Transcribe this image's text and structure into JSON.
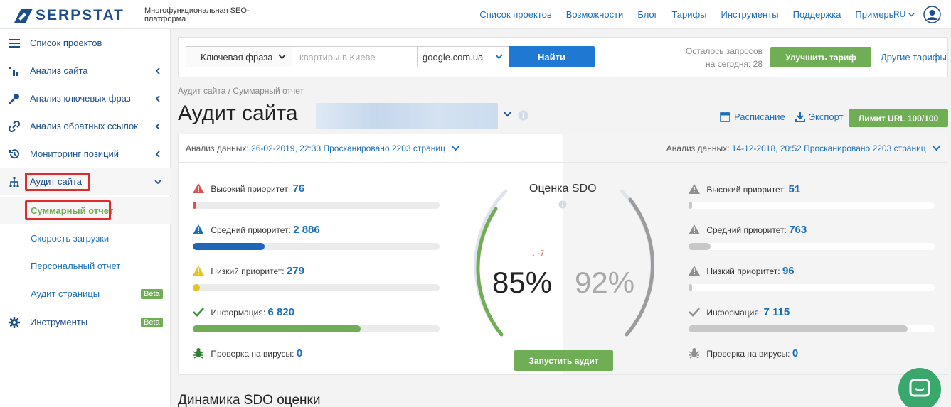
{
  "header": {
    "logo": "SERPSTAT",
    "tagline": "Многофункциональная SEO-платформа",
    "nav": [
      "Список проектов",
      "Возможности",
      "Блог",
      "Тарифы",
      "Инструменты",
      "Поддержка",
      "Примеры"
    ],
    "lang": "RU"
  },
  "sidebar": {
    "items": [
      {
        "label": "Список проектов",
        "icon": "menu-icon"
      },
      {
        "label": "Анализ сайта",
        "icon": "bar-chart-icon"
      },
      {
        "label": "Анализ ключевых фраз",
        "icon": "key-icon"
      },
      {
        "label": "Анализ обратных ссылок",
        "icon": "link-icon"
      },
      {
        "label": "Мониторинг позиций",
        "icon": "history-icon"
      },
      {
        "label": "Аудит сайта",
        "icon": "sitemap-icon"
      }
    ],
    "sub": [
      "Суммарный отчет",
      "Скорость загрузки",
      "Персональный отчет",
      "Аудит страницы"
    ],
    "beta": "Beta",
    "tools": "Инструменты"
  },
  "search": {
    "type": "Ключевая фраза",
    "placeholder": "квартиры в Киеве",
    "engine": "google.com.ua",
    "button": "Найти",
    "quota_line1": "Осталось запросов",
    "quota_line2": "на сегодня: 28",
    "upgrade": "Улучшить тариф",
    "other": "Другие тарифы"
  },
  "page": {
    "breadcrumb": "Аудит сайта / Суммарный отчет",
    "title": "Аудит сайта",
    "schedule": "Расписание",
    "export": "Экспорт",
    "limit": "Лимит URL 100/100"
  },
  "left": {
    "data_label": "Анализ данных:",
    "data_value": "26-02-2019, 22:33 Просканировано 2203 страниц",
    "high_label": "Высокий приоритет:",
    "high": "76",
    "high_fill": 0.01,
    "mid_label": "Средний приоритет:",
    "mid": "2 886",
    "mid_fill": 0.29,
    "low_label": "Низкий приоритет:",
    "low": "279",
    "low_fill": 0.03,
    "info_label": "Информация:",
    "info": "6 820",
    "info_fill": 0.68,
    "virus_label": "Проверка на вирусы:",
    "virus": "0"
  },
  "right": {
    "data_label": "Анализ данных:",
    "data_value": "14-12-2018, 20:52 Просканировано 2203 страниц",
    "high_label": "Высокий приоритет:",
    "high": "51",
    "high_fill": 0.005,
    "mid_label": "Средний приоритет:",
    "mid": "763",
    "mid_fill": 0.09,
    "low_label": "Низкий приоритет:",
    "low": "96",
    "low_fill": 0.005,
    "info_label": "Информация:",
    "info": "7 115",
    "info_fill": 0.89,
    "virus_label": "Проверка на вирусы:",
    "virus": "0"
  },
  "sdo": {
    "title": "Оценка SDO",
    "current": "85%",
    "previous": "92%",
    "delta": "-7",
    "current_value": 85,
    "previous_value": 92,
    "run": "Запустить аудит"
  },
  "dynamics": "Динамика SDO оценки",
  "colors": {
    "accent": "#1b6fb8",
    "green": "#6fae54",
    "red": "#e02b2b"
  }
}
